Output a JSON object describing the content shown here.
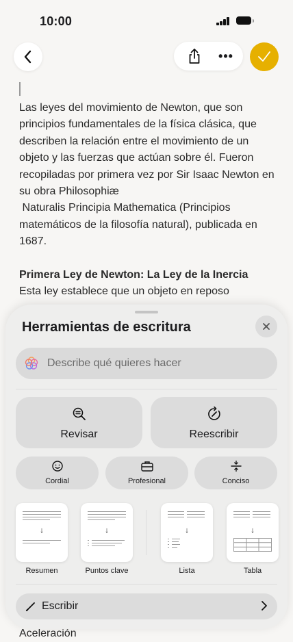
{
  "status_bar": {
    "time": "10:00"
  },
  "toolbar": {
    "back_icon": "chevron-left-icon",
    "share_icon": "share-icon",
    "more_label": "•••",
    "done_icon": "checkmark-icon",
    "accent_color": "#e6b000"
  },
  "note": {
    "paragraph1": "Las leyes del movimiento de Newton, que son principios fundamentales de la física clásica, que describen la relación entre el movimiento de un objeto y las fuerzas que actúan sobre él. Fueron recopiladas por primera vez por Sir Isaac Newton en su obra Philosophiæ",
    "paragraph2": " Naturalis Principia Mathematica (Principios matemáticos de la filosofía natural), publicada en 1687.",
    "heading": "Primera Ley de Newton: La Ley de la Inercia",
    "paragraph3": "Esta ley establece que un objeto en reposo",
    "trailing": "Aceleración"
  },
  "writing_tools": {
    "title": "Herramientas de escritura",
    "close_icon": "close-icon",
    "prompt_placeholder": "Describe qué quieres hacer",
    "proofread_label": "Revisar",
    "rewrite_label": "Reescribir",
    "friendly_label": "Cordial",
    "professional_label": "Profesional",
    "concise_label": "Conciso",
    "summary_label": "Resumen",
    "key_points_label": "Puntos clave",
    "list_label": "Lista",
    "table_label": "Tabla",
    "compose_label": "Escribir"
  }
}
